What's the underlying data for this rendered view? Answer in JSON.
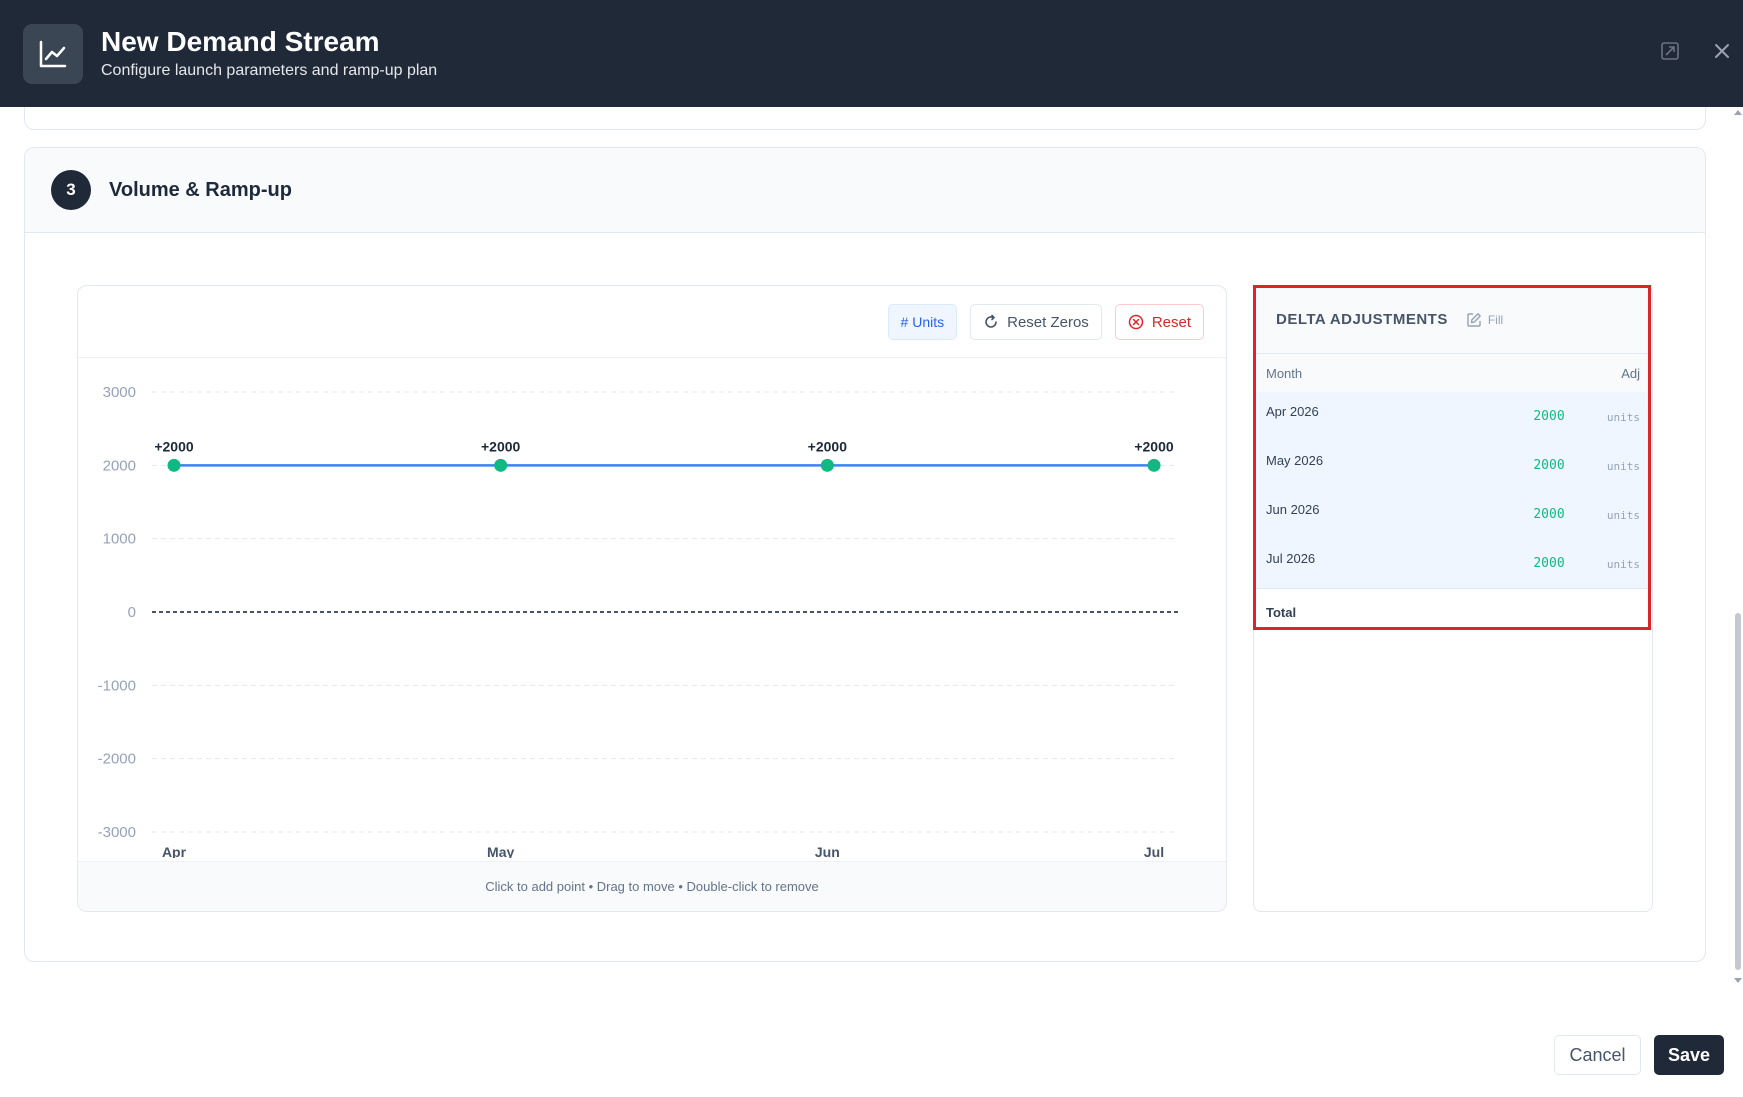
{
  "header": {
    "title": "New Demand Stream",
    "subtitle": "Configure launch parameters and ramp-up plan",
    "icon": "chart-line-icon"
  },
  "section": {
    "number": "3",
    "title": "Volume & Ramp-up"
  },
  "toolbar": {
    "units_label": "# Units",
    "reset_zeros_label": "Reset Zeros",
    "reset_label": "Reset"
  },
  "chart_hint": "Click to add point • Drag to move • Double-click to remove",
  "chart_data": {
    "type": "line",
    "categories": [
      "Apr",
      "May",
      "Jun",
      "Jul"
    ],
    "values": [
      2000,
      2000,
      2000,
      2000
    ],
    "point_labels": [
      "+2000",
      "+2000",
      "+2000",
      "+2000"
    ],
    "y_ticks": [
      "3000",
      "2000",
      "1000",
      "0",
      "-1000",
      "-2000",
      "-3000"
    ],
    "ylim": [
      -3000,
      3000
    ],
    "grid": true,
    "zero_line": true,
    "colors": {
      "line": "#3b82f6",
      "point": "#10b981",
      "zero": "#475569"
    }
  },
  "delta": {
    "title": "DELTA ADJUSTMENTS",
    "fill_label": "Fill",
    "col_month": "Month",
    "col_adj": "Adj",
    "rows": [
      {
        "month": "Apr 2026",
        "value": "2000",
        "unit": "units"
      },
      {
        "month": "May 2026",
        "value": "2000",
        "unit": "units"
      },
      {
        "month": "Jun 2026",
        "value": "2000",
        "unit": "units"
      },
      {
        "month": "Jul 2026",
        "value": "2000",
        "unit": "units"
      }
    ],
    "total_label": "Total"
  },
  "footer": {
    "cancel_label": "Cancel",
    "save_label": "Save"
  }
}
